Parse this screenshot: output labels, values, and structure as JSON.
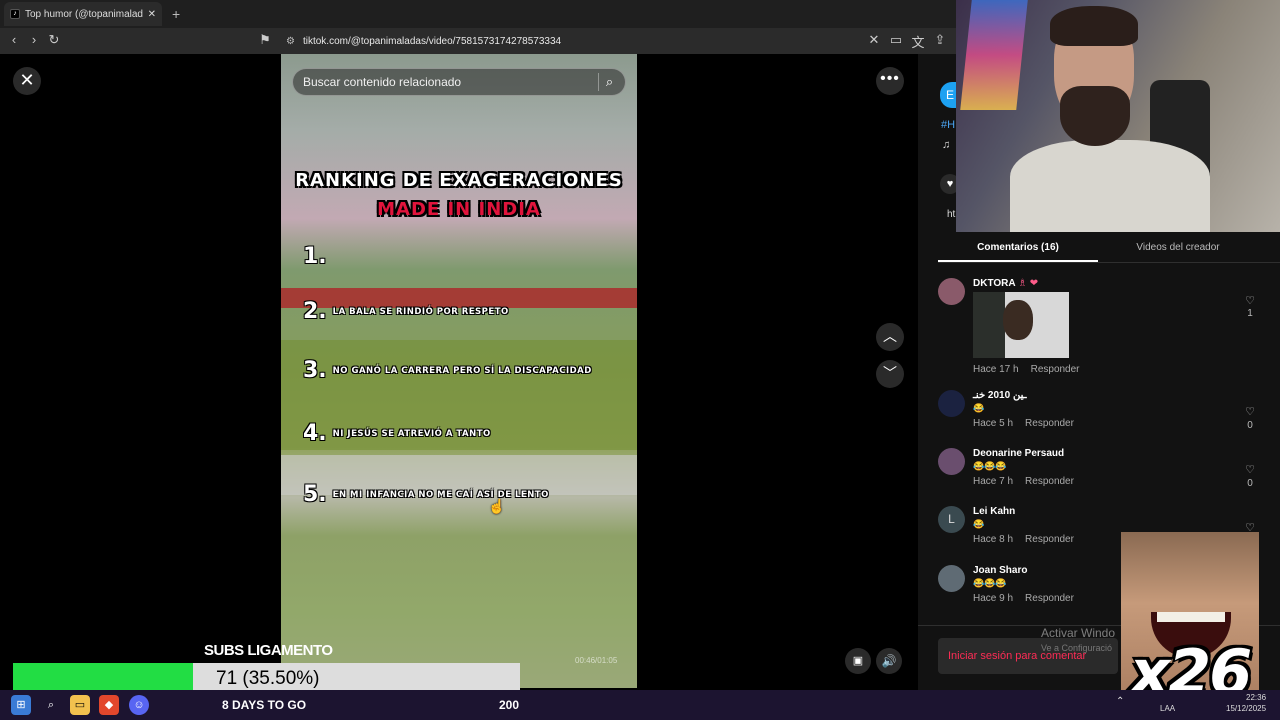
{
  "browser": {
    "tab_title": "Top humor (@topanimaladas",
    "tab_close": "✕",
    "new_tab": "+",
    "url": "tiktok.com/@topanimaladas/video/7581573174278573334",
    "back": "‹",
    "forward": "›",
    "reload": "↻"
  },
  "video": {
    "search_placeholder": "Buscar contenido relacionado",
    "title_line1": "Ranking de exageraciones",
    "title_line2": "made in India",
    "ranking": [
      {
        "num": "1.",
        "text": ""
      },
      {
        "num": "2.",
        "text": "La bala se rindió por respeto"
      },
      {
        "num": "3.",
        "text": "No ganó la carrera pero sí la discapacidad"
      },
      {
        "num": "4.",
        "text": "Ni Jesús se atrevió a tanto"
      },
      {
        "num": "5.",
        "text": "En mi infancia no me caí así de lento"
      }
    ],
    "time_readout": "00:46/01:05"
  },
  "side": {
    "hashtag": "#H",
    "music": "♫",
    "link_fragment": "ht",
    "profile_initial": "E"
  },
  "tabs": {
    "comments": "Comentarios (16)",
    "creator_videos": "Videos del creador"
  },
  "comments": [
    {
      "user": "DKTORA",
      "user_suffix": "♗ ❤",
      "avatar": "",
      "emoji": "",
      "time": "Hace 17 h",
      "reply": "Responder",
      "likes": "1"
    },
    {
      "user": "ـين 2010 خنـ",
      "user_suffix": "",
      "avatar": "",
      "emoji": "😂",
      "time": "Hace 5 h",
      "reply": "Responder",
      "likes": "0"
    },
    {
      "user": "Deonarine Persaud",
      "user_suffix": "",
      "avatar": "",
      "emoji": "😂😂😂",
      "time": "Hace 7 h",
      "reply": "Responder",
      "likes": "0"
    },
    {
      "user": "Lei Kahn",
      "user_suffix": "",
      "avatar": "L",
      "emoji": "😂",
      "time": "Hace 8 h",
      "reply": "Responder",
      "likes": ""
    },
    {
      "user": "Joan Sharo",
      "user_suffix": "",
      "avatar": "",
      "emoji": "😂😂😂",
      "time": "Hace 9 h",
      "reply": "Responder",
      "likes": ""
    }
  ],
  "login_prompt": "Iniciar sesión para comentar",
  "windows_watermark": {
    "line1": "Activar Windo",
    "line2": "Ve a Configuració"
  },
  "overlay": {
    "multiplier": "x26",
    "subgoal_title": "SUBS LIGAMENTO",
    "subgoal_text": "71 (35.50%)",
    "subgoal_progress": 0.355,
    "days_to_go": "8 DAYS TO GO",
    "goal_target": "200"
  },
  "taskbar": {
    "lang": "LAA",
    "time": "22:36",
    "date": "15/12/2025"
  },
  "colors": {
    "accent_red": "#fe2c55",
    "progress_green": "#22dd44",
    "link_blue": "#4aa3f0"
  }
}
